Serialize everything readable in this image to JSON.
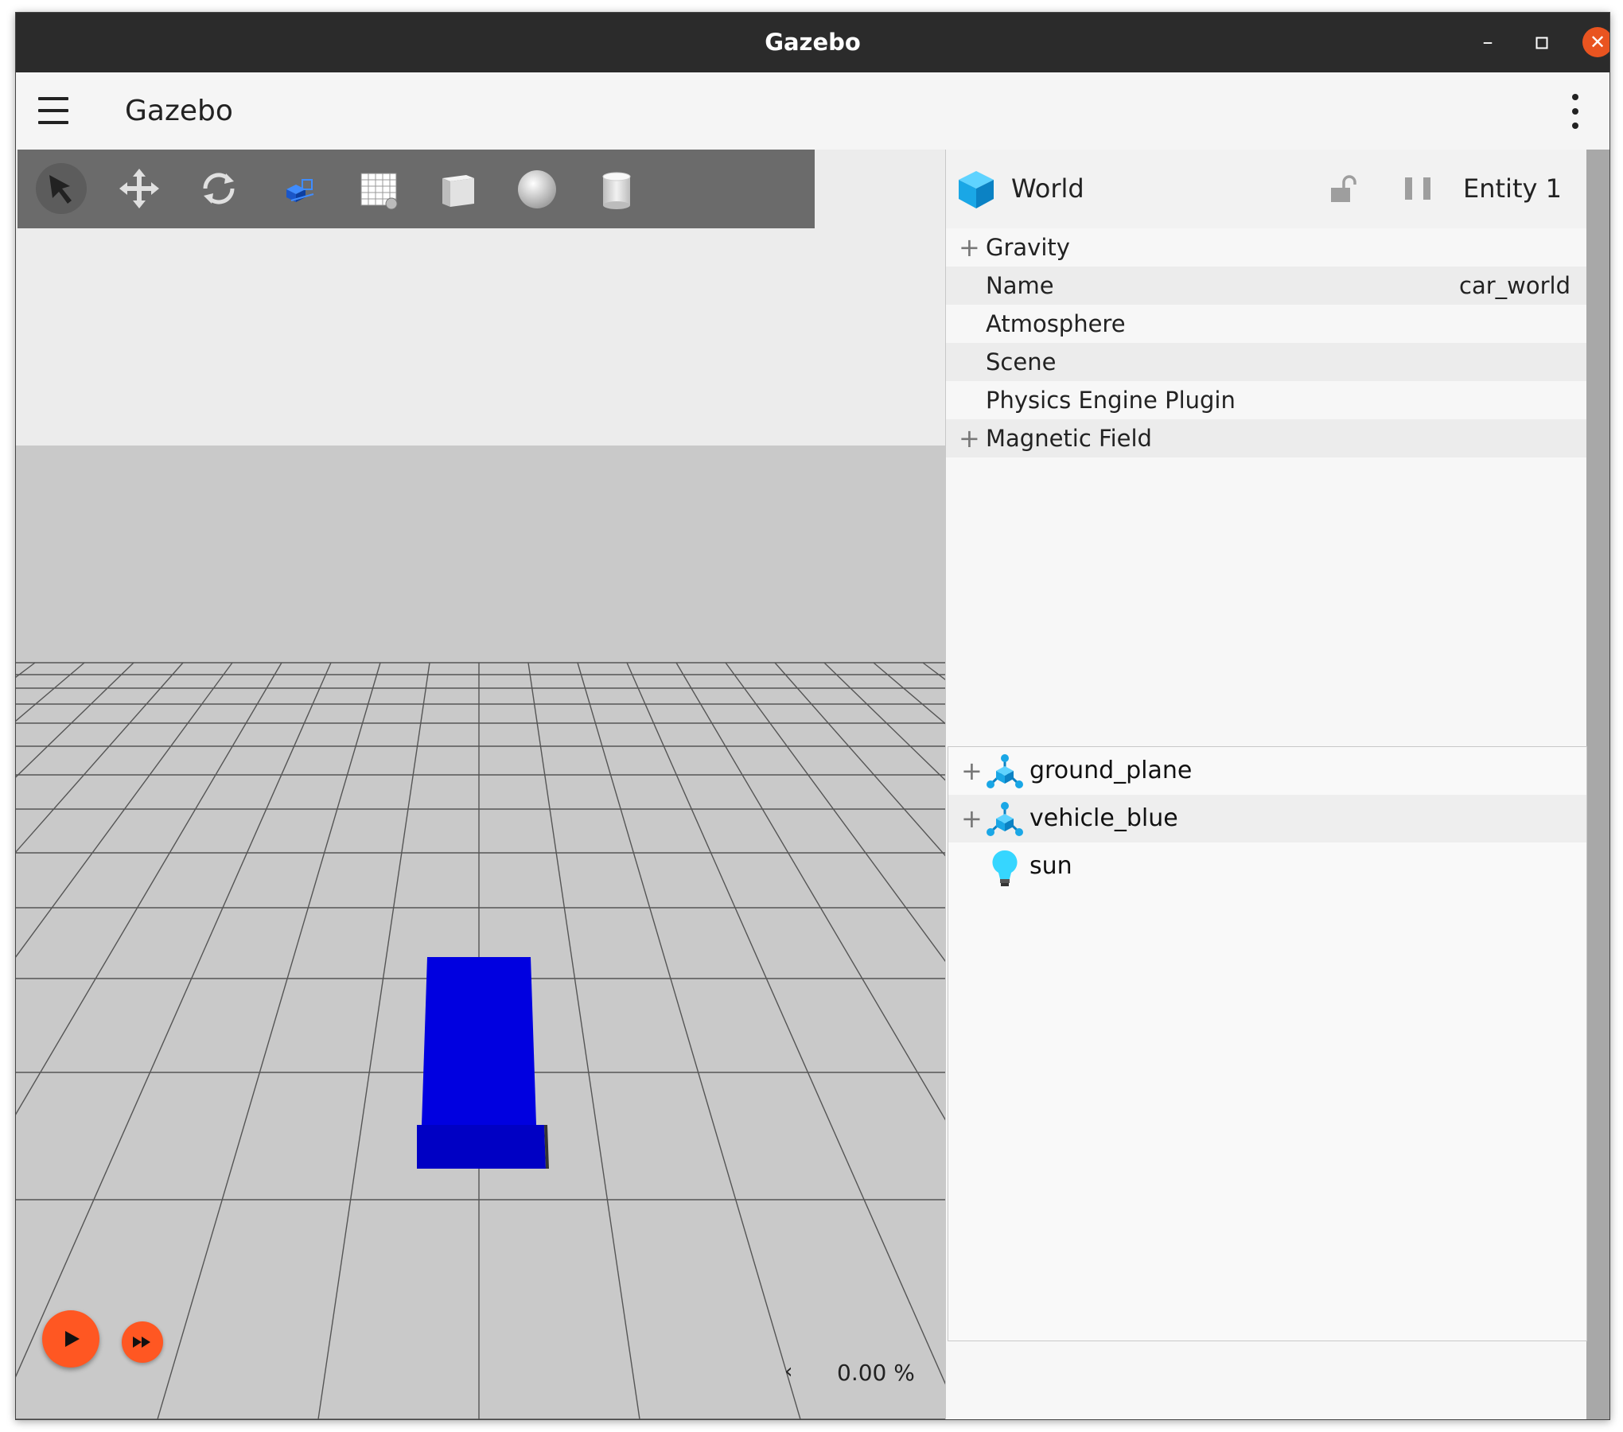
{
  "window": {
    "title": "Gazebo",
    "minimize_glyph": "–",
    "maximize_glyph": "□",
    "close_glyph": "✕"
  },
  "appbar": {
    "title": "Gazebo",
    "menu_icon": "hamburger-menu-icon",
    "overflow_icon": "kebab-menu-icon"
  },
  "toolbar": {
    "tools": [
      "select-icon",
      "translate-icon",
      "rotate-icon",
      "transform-control-icon",
      "grid-snap-icon",
      "box-shape-icon",
      "sphere-shape-icon",
      "cylinder-shape-icon"
    ]
  },
  "scene": {
    "sky_color": "#ececec",
    "ground_color": "#c9c9c9",
    "model_color": "#0000dd"
  },
  "playback": {
    "play_icon": "play-icon",
    "step_icon": "fast-forward-icon",
    "real_time_factor": "0.00 %",
    "arrow_glyph": "‹"
  },
  "component_inspector": {
    "entity_type": "World",
    "entity_label": "Entity 1",
    "properties": [
      {
        "label": "Gravity",
        "expandable": true,
        "value": ""
      },
      {
        "label": "Name",
        "expandable": false,
        "value": "car_world"
      },
      {
        "label": "Atmosphere",
        "expandable": false,
        "value": ""
      },
      {
        "label": "Scene",
        "expandable": false,
        "value": ""
      },
      {
        "label": "Physics Engine Plugin",
        "expandable": false,
        "value": ""
      },
      {
        "label": "Magnetic Field",
        "expandable": true,
        "value": ""
      }
    ]
  },
  "entity_tree": {
    "items": [
      {
        "label": "ground_plane",
        "icon": "model-icon",
        "expandable": true
      },
      {
        "label": "vehicle_blue",
        "icon": "model-icon",
        "expandable": true
      },
      {
        "label": "sun",
        "icon": "light-bulb-icon",
        "expandable": false
      }
    ]
  },
  "colors": {
    "accent": "#ff5722",
    "titlebar": "#2b2b2b",
    "close_button": "#e95420"
  }
}
